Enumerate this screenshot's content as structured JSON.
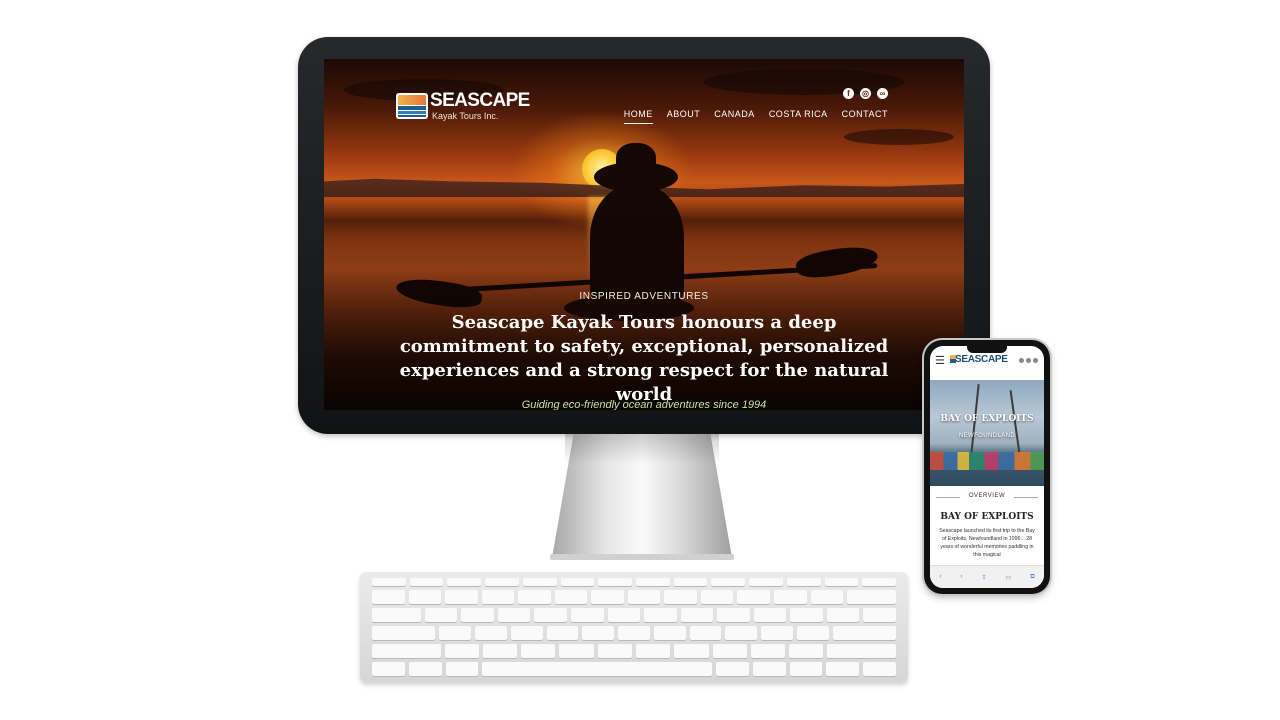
{
  "desktop": {
    "logo": {
      "title": "SEASCAPE",
      "subtitle": "Kayak Tours Inc."
    },
    "social": [
      {
        "icon": "facebook-icon",
        "glyph": "f"
      },
      {
        "icon": "instagram-icon",
        "glyph": "◎"
      },
      {
        "icon": "tripadvisor-icon",
        "glyph": "∞"
      }
    ],
    "nav": [
      {
        "label": "HOME",
        "active": true
      },
      {
        "label": "ABOUT",
        "active": false
      },
      {
        "label": "CANADA",
        "active": false
      },
      {
        "label": "COSTA RICA",
        "active": false
      },
      {
        "label": "CONTACT",
        "active": false
      }
    ],
    "hero": {
      "kicker": "INSPIRED ADVENTURES",
      "headline": "Seascape Kayak Tours honours a deep commitment to safety, exceptional, personalized experiences and a strong respect for the natural world",
      "tagline": "Guiding eco-friendly ocean adventures since 1994"
    }
  },
  "mobile": {
    "logo": "SEASCAPE",
    "hero_title": "BAY OF EXPLOITS",
    "hero_subtitle": "NEWFOUNDLAND",
    "section_label": "OVERVIEW",
    "section_title": "BAY OF EXPLOITS",
    "section_body": "Seascape launched its first trip to the Bay of Exploits, Newfoundland in 1996... 28 years of wonderful memories paddling in this magical"
  }
}
